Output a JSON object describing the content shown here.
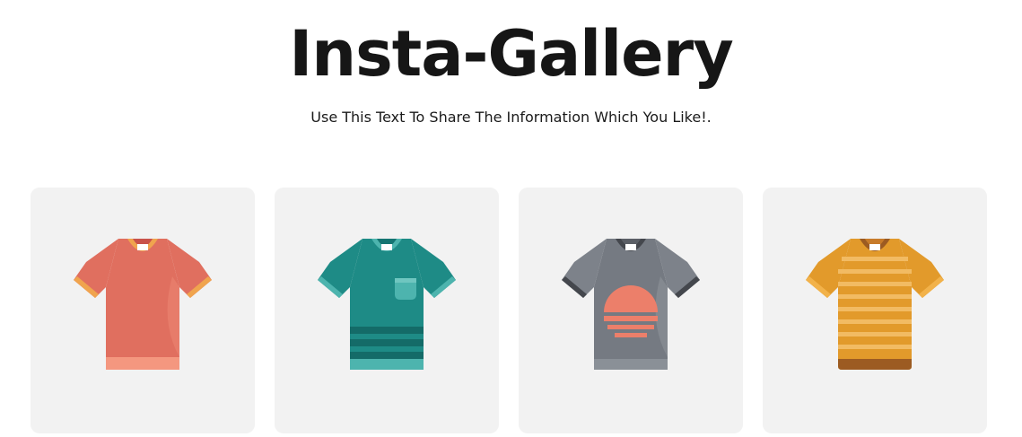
{
  "header": {
    "title": "Insta-Gallery",
    "subtitle": "Use This Text To Share The Information Which You Like!."
  },
  "gallery": {
    "items": [
      {
        "icon": "red-tshirt-icon",
        "body_color": "#e06f5f",
        "trim_color": "#f0a44e"
      },
      {
        "icon": "teal-pocket-tshirt-icon",
        "body_color": "#1e8b86",
        "trim_color": "#4db4ae"
      },
      {
        "icon": "gray-graphic-tshirt-icon",
        "body_color": "#757a82",
        "trim_color": "#44474d"
      },
      {
        "icon": "yellow-striped-tshirt-icon",
        "body_color": "#e29a2b",
        "trim_color": "#9c5b22"
      }
    ]
  }
}
